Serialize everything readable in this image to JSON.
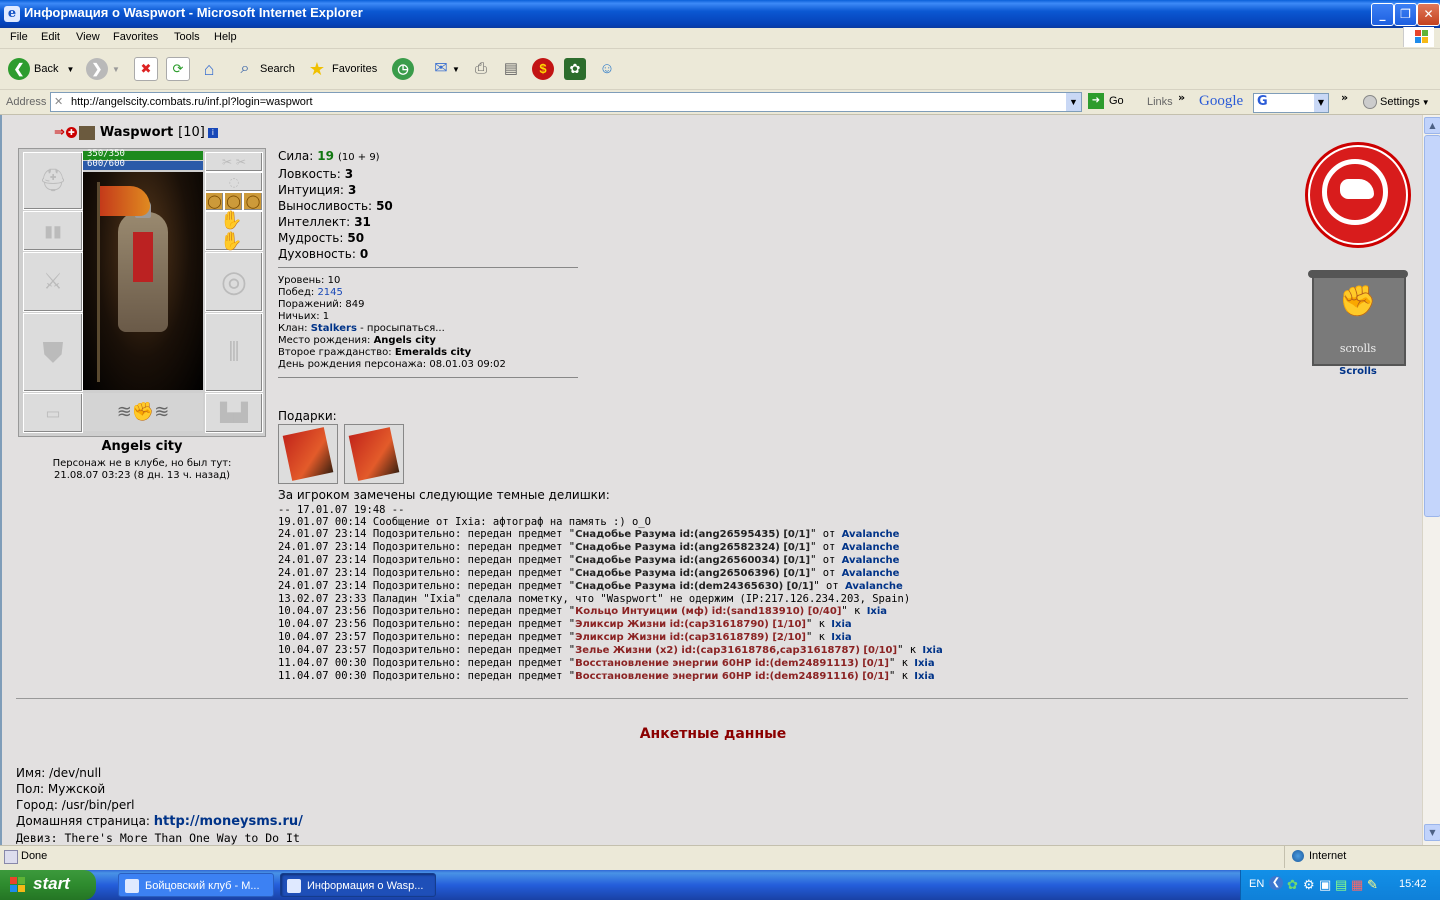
{
  "window": {
    "title": "Информация о Waspwort - Microsoft Internet Explorer"
  },
  "menu": [
    "File",
    "Edit",
    "View",
    "Favorites",
    "Tools",
    "Help"
  ],
  "toolbar": {
    "back": "Back",
    "search": "Search",
    "favorites": "Favorites"
  },
  "address": {
    "label": "Address",
    "url": "http://angelscity.combats.ru/inf.pl?login=waspwort",
    "go": "Go",
    "links": "Links",
    "google": "Google",
    "settings": "Settings"
  },
  "profile": {
    "name": "Waspwort",
    "level_tag": "[10]",
    "hp": "350/350",
    "mana": "600/600",
    "hp_fraction": 1.0,
    "mana_fraction": 1.0,
    "city": "Angels city",
    "club_note_1": "Персонаж не в клубе, но был тут:",
    "club_note_2": "21.08.07 03:23 (8 дн. 13 ч. назад)",
    "stats": [
      {
        "label": "Сила:",
        "value": "19",
        "extra": "(10 + 9)",
        "color": "#117711"
      },
      {
        "label": "Ловкость:",
        "value": "3",
        "extra": ""
      },
      {
        "label": "Интуиция:",
        "value": "3",
        "extra": ""
      },
      {
        "label": "Выносливость:",
        "value": "50",
        "extra": ""
      },
      {
        "label": "Интеллект:",
        "value": "31",
        "extra": ""
      },
      {
        "label": "Мудрость:",
        "value": "50",
        "extra": ""
      },
      {
        "label": "Духовность:",
        "value": "0",
        "extra": ""
      }
    ],
    "info": {
      "level": "Уровень: 10",
      "wins_label": "Побед:",
      "wins": "2145",
      "losses": "Поражений: 849",
      "draws": "Ничьих: 1",
      "clan_label": "Клан:",
      "clan": "Stalkers",
      "clan_note": "- просыпаться...",
      "birthplace_label": "Место рождения:",
      "birthplace": "Angels city",
      "second_citizenship_label": "Второе гражданство:",
      "second_citizenship": "Emeralds city",
      "birthday": "День рождения персонажа: 08.01.03 09:02"
    },
    "gifts_label": "Подарки:",
    "clan_logo_label": "Scrolls"
  },
  "dark_deeds": {
    "title": "За игроком замечены следующие темные делишки:",
    "lines": [
      {
        "pre": "-- 17.01.07 19:48 --",
        "item": "",
        "post": "",
        "who": ""
      },
      {
        "pre": "19.01.07 00:14 Сообщение от Ixia: афтограф на память :) o_O",
        "item": "",
        "post": "",
        "who": ""
      },
      {
        "pre": "24.01.07 23:14 Подозрительно: передан предмет \"",
        "item": "Снадобье Разума id:(ang26595435) [0/1]",
        "post": "\" от ",
        "who": "Avalanche",
        "style": "dark"
      },
      {
        "pre": "24.01.07 23:14 Подозрительно: передан предмет \"",
        "item": "Снадобье Разума id:(ang26582324) [0/1]",
        "post": "\" от ",
        "who": "Avalanche",
        "style": "dark"
      },
      {
        "pre": "24.01.07 23:14 Подозрительно: передан предмет \"",
        "item": "Снадобье Разума id:(ang26560034) [0/1]",
        "post": "\" от ",
        "who": "Avalanche",
        "style": "dark"
      },
      {
        "pre": "24.01.07 23:14 Подозрительно: передан предмет \"",
        "item": "Снадобье Разума id:(ang26506396) [0/1]",
        "post": "\" от ",
        "who": "Avalanche",
        "style": "dark"
      },
      {
        "pre": "24.01.07 23:14 Подозрительно: передан предмет \"",
        "item": "Снадобье Разума id:(dem24365630) [0/1]",
        "post": "\" от ",
        "who": "Avalanche",
        "style": "dark"
      },
      {
        "pre": "13.02.07 23:33 Паладин \"Ixia\" сделала пометку, что \"Waspwort\" не одержим (IP:217.126.234.203, Spain)",
        "item": "",
        "post": "",
        "who": ""
      },
      {
        "pre": "10.04.07 23:56 Подозрительно: передан предмет \"",
        "item": "Кольцо Интуиции (мф) id:(sand183910) [0/40]",
        "post": "\" к ",
        "who": "Ixia",
        "style": "red"
      },
      {
        "pre": "10.04.07 23:56 Подозрительно: передан предмет \"",
        "item": "Эликсир Жизни id:(cap31618790) [1/10]",
        "post": "\" к ",
        "who": "Ixia",
        "style": "red"
      },
      {
        "pre": "10.04.07 23:57 Подозрительно: передан предмет \"",
        "item": "Эликсир Жизни id:(cap31618789) [2/10]",
        "post": "\" к ",
        "who": "Ixia",
        "style": "red"
      },
      {
        "pre": "10.04.07 23:57 Подозрительно: передан предмет \"",
        "item": "Зелье Жизни (x2) id:(cap31618786,cap31618787) [0/10]",
        "post": "\" к ",
        "who": "Ixia",
        "style": "red"
      },
      {
        "pre": "11.04.07 00:30 Подозрительно: передан предмет \"",
        "item": "Восстановление энергии 60HP id:(dem24891113) [0/1]",
        "post": "\" к ",
        "who": "Ixia",
        "style": "red"
      },
      {
        "pre": "11.04.07 00:30 Подозрительно: передан предмет \"",
        "item": "Восстановление энергии 60HP id:(dem24891116) [0/1]",
        "post": "\" к ",
        "who": "Ixia",
        "style": "red"
      }
    ]
  },
  "anketa": {
    "title": "Анкетные данные",
    "name": "Имя: /dev/null",
    "gender": "Пол: Мужской",
    "city": "Город: /usr/bin/perl",
    "homepage_label": "Домашняя страница:",
    "homepage": "http://moneysms.ru/",
    "motto": "Девиз: There's More Than One Way to Do It"
  },
  "status": {
    "text": "Done",
    "zone": "Internet"
  },
  "taskbar": {
    "start": "start",
    "tasks": [
      "Бойцовский клуб - М...",
      "Информация о Wasp..."
    ],
    "lang": "EN",
    "clock": "15:42"
  }
}
